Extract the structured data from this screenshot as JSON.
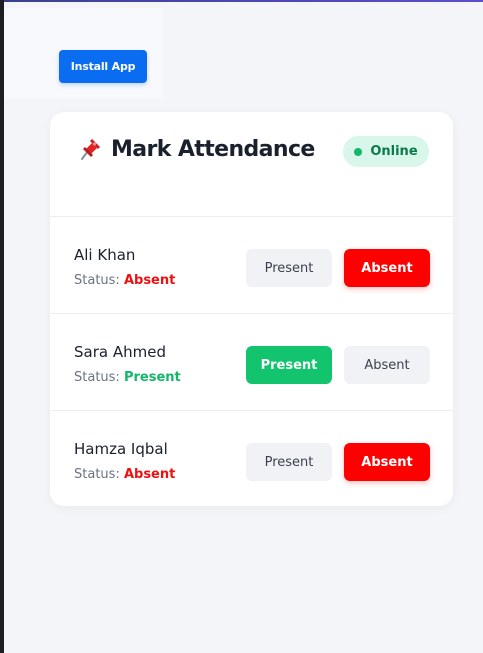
{
  "header": {
    "install_label": "Install App"
  },
  "card": {
    "title": "Mark Attendance",
    "online_label": "Online"
  },
  "status_label": "Status:",
  "students": [
    {
      "name": "Ali Khan",
      "status": "Absent",
      "present_label": "Present",
      "absent_label": "Absent"
    },
    {
      "name": "Sara Ahmed",
      "status": "Present",
      "present_label": "Present",
      "absent_label": "Absent"
    },
    {
      "name": "Hamza Iqbal",
      "status": "Absent",
      "present_label": "Present",
      "absent_label": "Absent"
    }
  ],
  "colors": {
    "primary": "#0a6cf0",
    "present": "#12c46e",
    "absent": "#ff0000",
    "online_bg": "#d8f6ea"
  },
  "icons": {
    "title_icon": "pushpin-icon",
    "online_indicator": "status-dot-icon"
  }
}
